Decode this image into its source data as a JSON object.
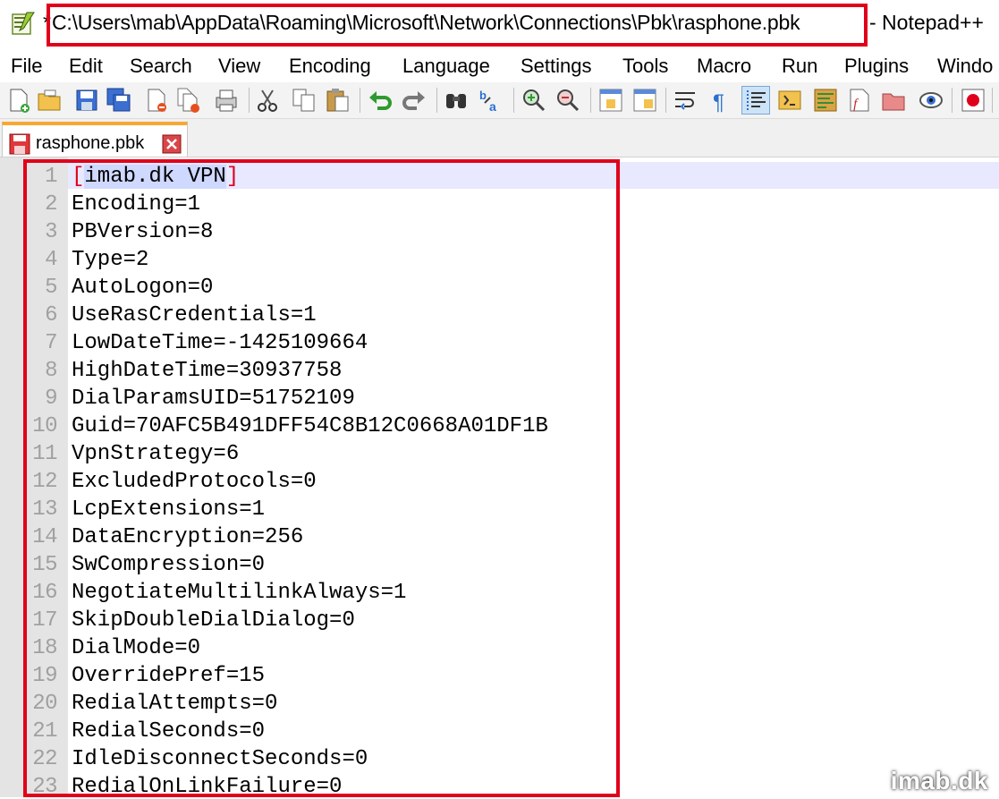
{
  "window": {
    "modified_marker": "*",
    "file_path": "C:\\Users\\mab\\AppData\\Roaming\\Microsoft\\Network\\Connections\\Pbk\\rasphone.pbk",
    "app_suffix": "- Notepad++"
  },
  "menu": [
    "File",
    "Edit",
    "Search",
    "View",
    "Encoding",
    "Language",
    "Settings",
    "Tools",
    "Macro",
    "Run",
    "Plugins",
    "Windo"
  ],
  "toolbar_icons": [
    "new-file-icon",
    "open-file-icon",
    "save-icon",
    "save-all-icon",
    "close-icon",
    "close-all-icon",
    "print-icon",
    "cut-icon",
    "copy-icon",
    "paste-icon",
    "undo-icon",
    "redo-icon",
    "find-icon",
    "replace-icon",
    "zoom-in-icon",
    "zoom-out-icon",
    "sync-vertical-icon",
    "sync-horizontal-icon",
    "word-wrap-icon",
    "show-all-chars-icon",
    "indent-guide-icon",
    "lang-icon",
    "doc-map-icon",
    "function-list-icon",
    "folder-workspace-icon",
    "monitor-icon",
    "record-macro-icon"
  ],
  "tab": {
    "label": "rasphone.pbk"
  },
  "editor": {
    "lines": [
      {
        "num": "1",
        "text": "imab.dk VPN",
        "section": true
      },
      {
        "num": "2",
        "text": "Encoding=1"
      },
      {
        "num": "3",
        "text": "PBVersion=8"
      },
      {
        "num": "4",
        "text": "Type=2"
      },
      {
        "num": "5",
        "text": "AutoLogon=0"
      },
      {
        "num": "6",
        "text": "UseRasCredentials=1"
      },
      {
        "num": "7",
        "text": "LowDateTime=-1425109664"
      },
      {
        "num": "8",
        "text": "HighDateTime=30937758"
      },
      {
        "num": "9",
        "text": "DialParamsUID=51752109"
      },
      {
        "num": "10",
        "text": "Guid=70AFC5B491DFF54C8B12C0668A01DF1B"
      },
      {
        "num": "11",
        "text": "VpnStrategy=6"
      },
      {
        "num": "12",
        "text": "ExcludedProtocols=0"
      },
      {
        "num": "13",
        "text": "LcpExtensions=1"
      },
      {
        "num": "14",
        "text": "DataEncryption=256"
      },
      {
        "num": "15",
        "text": "SwCompression=0"
      },
      {
        "num": "16",
        "text": "NegotiateMultilinkAlways=1"
      },
      {
        "num": "17",
        "text": "SkipDoubleDialDialog=0"
      },
      {
        "num": "18",
        "text": "DialMode=0"
      },
      {
        "num": "19",
        "text": "OverridePref=15"
      },
      {
        "num": "20",
        "text": "RedialAttempts=0"
      },
      {
        "num": "21",
        "text": "RedialSeconds=0"
      },
      {
        "num": "22",
        "text": "IdleDisconnectSeconds=0"
      },
      {
        "num": "23",
        "text": "RedialOnLinkFailure=0"
      }
    ]
  },
  "watermark": "imab.dk",
  "colors": {
    "highlight_box": "#e0001b",
    "tab_accent": "#f7a833",
    "current_line": "#e8e8ff"
  }
}
